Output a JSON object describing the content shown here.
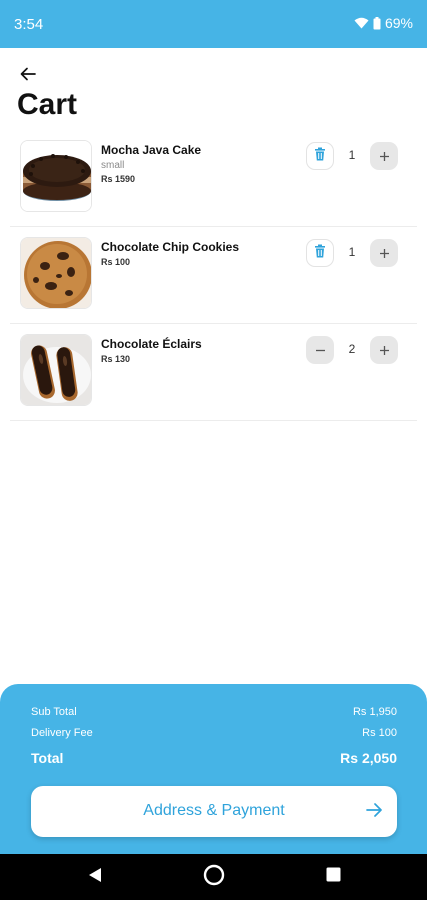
{
  "status_bar": {
    "time": "3:54",
    "battery": "69%"
  },
  "page": {
    "title": "Cart"
  },
  "cart_items": [
    {
      "name": "Mocha Java Cake",
      "variant": "small",
      "price": "Rs 1590",
      "quantity": "1",
      "image": "mocha-java-cake"
    },
    {
      "name": "Chocolate Chip Cookies",
      "variant": "",
      "price": "Rs 100",
      "quantity": "1",
      "image": "chocolate-chip-cookies"
    },
    {
      "name": "Chocolate Éclairs",
      "variant": "",
      "price": "Rs 130",
      "quantity": "2",
      "image": "chocolate-eclairs"
    }
  ],
  "summary": {
    "subtotal_label": "Sub Total",
    "subtotal_value": "Rs 1,950",
    "delivery_label": "Delivery Fee",
    "delivery_value": "Rs 100",
    "total_label": "Total",
    "total_value": "Rs 2,050"
  },
  "checkout_button": {
    "label": "Address & Payment"
  },
  "colors": {
    "accent": "#46b4e6",
    "button_text": "#2fa3db",
    "quantity_button": "#e7e7e7"
  },
  "icons": {
    "back": "arrow-left-icon",
    "delete": "trash-icon",
    "increase": "plus-icon",
    "decrease": "minus-icon",
    "checkout": "arrow-right-icon"
  }
}
